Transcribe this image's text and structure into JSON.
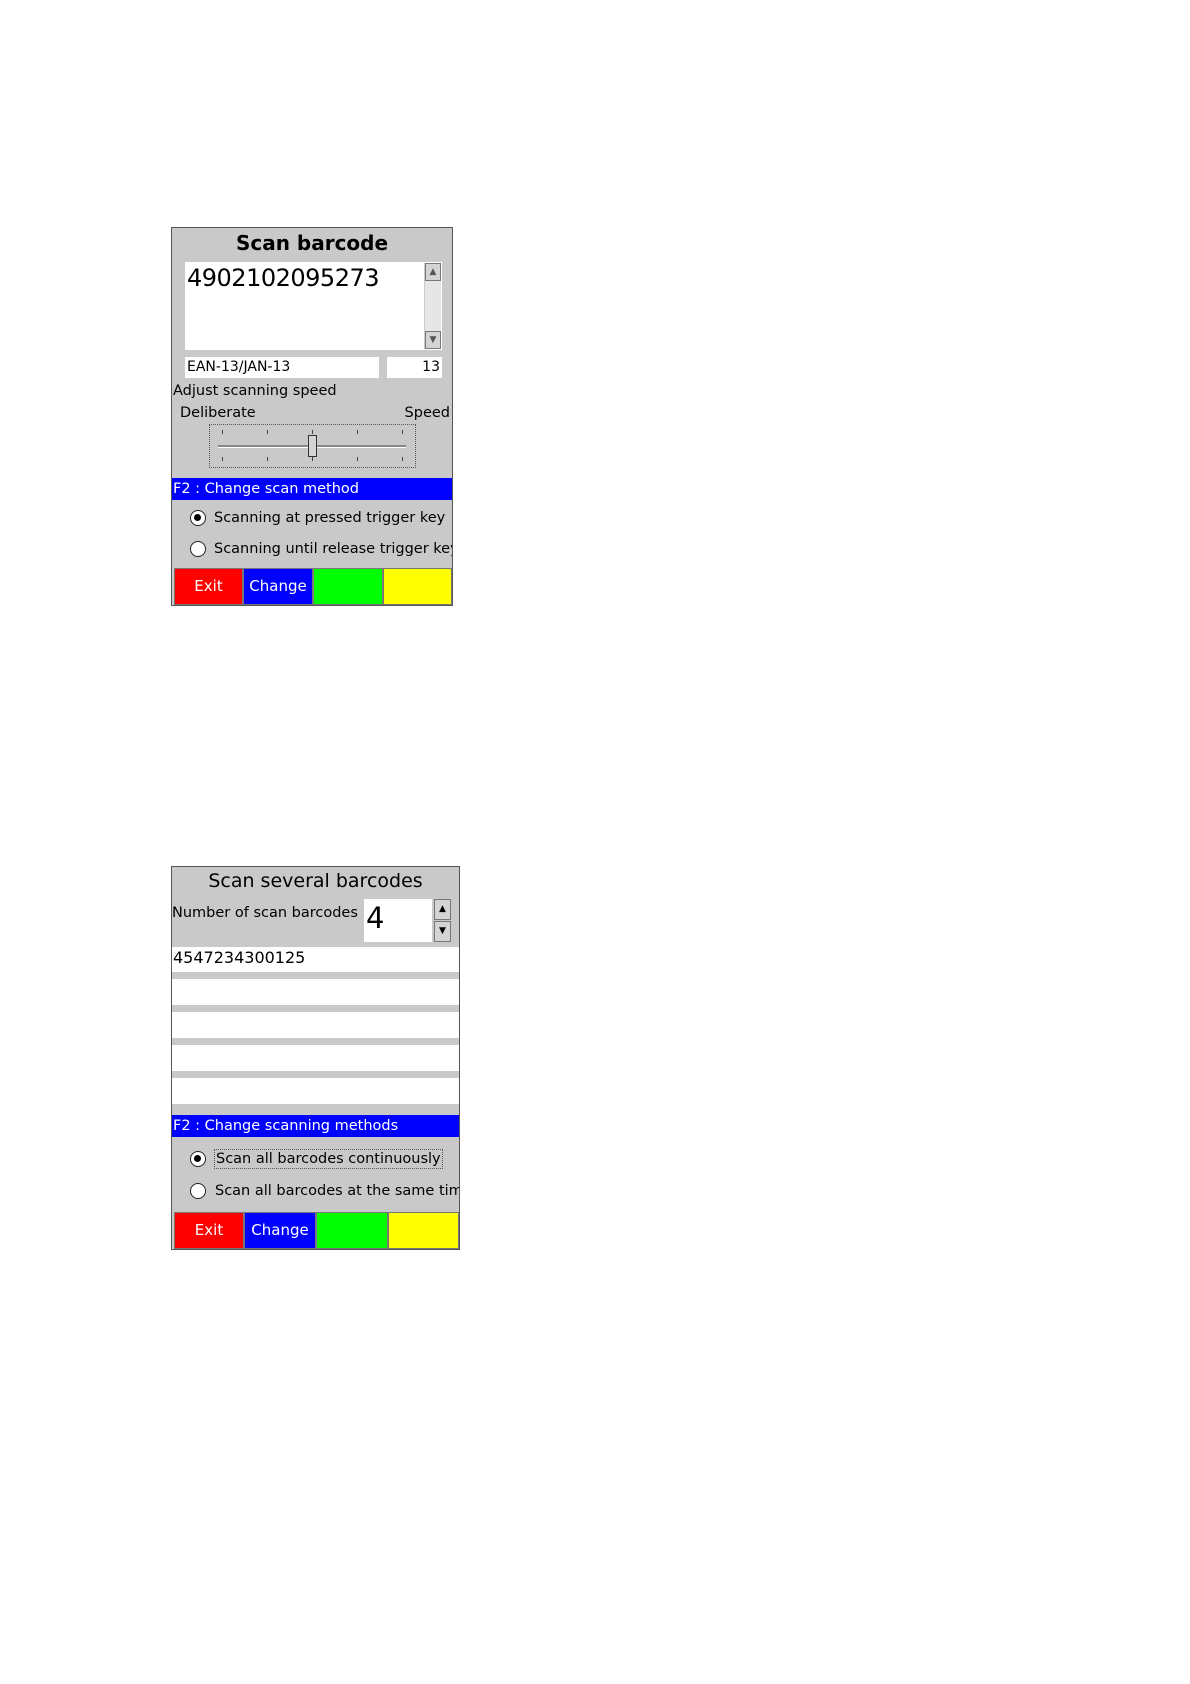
{
  "screen1": {
    "title": "Scan barcode",
    "barcode_value": "4902102095273",
    "barcode_type": "EAN-13/JAN-13",
    "digit_count": "13",
    "speed_label": "Adjust scanning speed",
    "speed_min_label": "Deliberate",
    "speed_max_label": "Speed",
    "speed_level": 0.5,
    "section_header": "F2 : Change scan method",
    "options": [
      {
        "label": "Scanning at pressed trigger key",
        "selected": true
      },
      {
        "label": "Scanning until release trigger key",
        "selected": false
      }
    ],
    "buttons": {
      "exit": "Exit",
      "change": "Change"
    },
    "colors": {
      "exit": "#ff0000",
      "change": "#0000ff",
      "green": "#00ff00",
      "yellow": "#ffff00"
    }
  },
  "screen2": {
    "title": "Scan several barcodes",
    "count_label": "Number of scan barcodes",
    "count_value": "4",
    "barcodes": [
      "4547234300125",
      "",
      "",
      "",
      ""
    ],
    "section_header": "F2 : Change scanning methods",
    "options": [
      {
        "label": "Scan all barcodes continuously",
        "selected": true
      },
      {
        "label": "Scan all barcodes at the same time",
        "selected": false
      }
    ],
    "buttons": {
      "exit": "Exit",
      "change": "Change"
    }
  }
}
